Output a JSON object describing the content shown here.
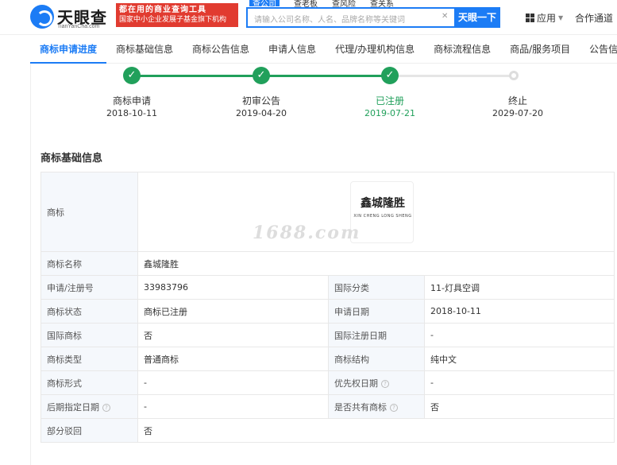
{
  "header": {
    "logo_text": "天眼查",
    "logo_sub": "TianYanCha.com",
    "banner_line1": "都在用的商业查询工具",
    "banner_line2": "国家中小企业发展子基金旗下机构",
    "search_tabs": [
      "查公司",
      "查老板",
      "查风险",
      "查关系"
    ],
    "search_placeholder": "请输入公司名称、人名、品牌名称等关键词",
    "search_button": "天眼一下",
    "apps_label": "应用",
    "coop_label": "合作通道"
  },
  "nav": {
    "tabs": [
      "商标申请进度",
      "商标基础信息",
      "商标公告信息",
      "申请人信息",
      "代理/办理机构信息",
      "商标流程信息",
      "商品/服务项目",
      "公告信息"
    ]
  },
  "timeline": {
    "steps": [
      {
        "label": "商标申请",
        "date": "2018-10-11",
        "status": "done"
      },
      {
        "label": "初审公告",
        "date": "2019-04-20",
        "status": "done"
      },
      {
        "label": "已注册",
        "date": "2019-07-21",
        "status": "current"
      },
      {
        "label": "终止",
        "date": "2029-07-20",
        "status": "pending"
      }
    ]
  },
  "section_title": "商标基础信息",
  "trademark": {
    "image_label": "商标",
    "image_text_cn": "鑫城隆胜",
    "image_text_py": "XIN CHENG LONG SHENG",
    "watermark": "1688.com"
  },
  "table": {
    "name_label": "商标名称",
    "name_value": "鑫城隆胜",
    "rows": [
      {
        "l1": "申请/注册号",
        "v1": "33983796",
        "l2": "国际分类",
        "v2": "11-灯具空调",
        "q1": false,
        "q2": false
      },
      {
        "l1": "商标状态",
        "v1": "商标已注册",
        "l2": "申请日期",
        "v2": "2018-10-11",
        "q1": false,
        "q2": false
      },
      {
        "l1": "国际商标",
        "v1": "否",
        "l2": "国际注册日期",
        "v2": "-",
        "q1": false,
        "q2": false
      },
      {
        "l1": "商标类型",
        "v1": "普通商标",
        "l2": "商标结构",
        "v2": "纯中文",
        "q1": false,
        "q2": false
      },
      {
        "l1": "商标形式",
        "v1": "-",
        "l2": "优先权日期",
        "v2": "-",
        "q1": false,
        "q2": true
      },
      {
        "l1": "后期指定日期",
        "v1": "-",
        "l2": "是否共有商标",
        "v2": "否",
        "q1": true,
        "q2": true
      }
    ],
    "last_label": "部分驳回",
    "last_value": "否"
  },
  "colors": {
    "brand": "#1c7cf5",
    "success": "#21a05b",
    "banner": "#e13b30"
  }
}
